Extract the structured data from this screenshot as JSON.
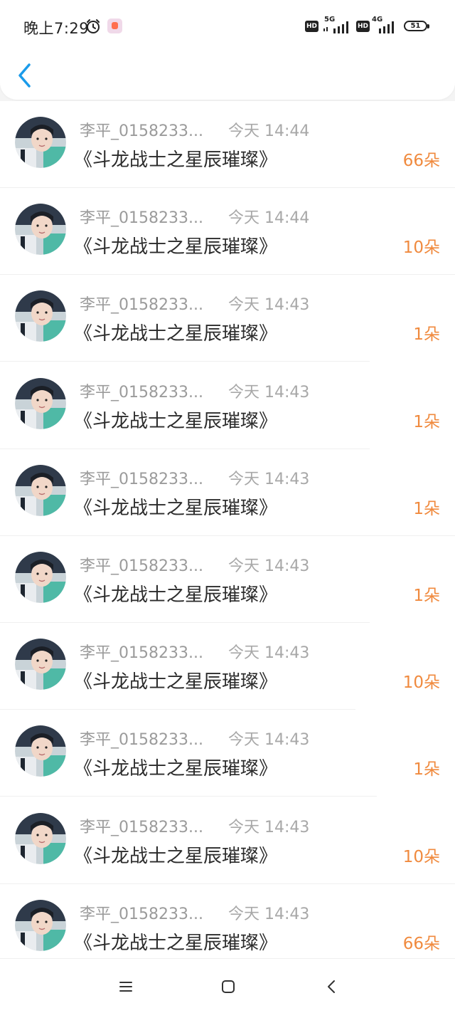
{
  "status_bar": {
    "time": "晚上7:29",
    "network_1": "5G",
    "network_2": "4G",
    "hd_label": "HD",
    "battery": "51"
  },
  "colors": {
    "accent_blue": "#1a9bea",
    "amount_orange": "#f08a3e"
  },
  "header": {
    "back_icon": "chevron-left-icon"
  },
  "gifts": [
    {
      "name": "李平_0158233...",
      "time": "今天 14:44",
      "title": "《斗龙战士之星辰璀璨》",
      "amount": "66朵"
    },
    {
      "name": "李平_0158233...",
      "time": "今天 14:44",
      "title": "《斗龙战士之星辰璀璨》",
      "amount": "10朵"
    },
    {
      "name": "李平_0158233...",
      "time": "今天 14:43",
      "title": "《斗龙战士之星辰璀璨》",
      "amount": "1朵"
    },
    {
      "name": "李平_0158233...",
      "time": "今天 14:43",
      "title": "《斗龙战士之星辰璀璨》",
      "amount": "1朵"
    },
    {
      "name": "李平_0158233...",
      "time": "今天 14:43",
      "title": "《斗龙战士之星辰璀璨》",
      "amount": "1朵"
    },
    {
      "name": "李平_0158233...",
      "time": "今天 14:43",
      "title": "《斗龙战士之星辰璀璨》",
      "amount": "1朵"
    },
    {
      "name": "李平_0158233...",
      "time": "今天 14:43",
      "title": "《斗龙战士之星辰璀璨》",
      "amount": "10朵"
    },
    {
      "name": "李平_0158233...",
      "time": "今天 14:43",
      "title": "《斗龙战士之星辰璀璨》",
      "amount": "1朵"
    },
    {
      "name": "李平_0158233...",
      "time": "今天 14:43",
      "title": "《斗龙战士之星辰璀璨》",
      "amount": "10朵"
    },
    {
      "name": "李平_0158233...",
      "time": "今天 14:43",
      "title": "《斗龙战士之星辰璀璨》",
      "amount": "66朵"
    }
  ],
  "nav": {
    "menu_icon": "menu-icon",
    "home_icon": "home-square-icon",
    "back_icon": "back-triangle-icon"
  }
}
